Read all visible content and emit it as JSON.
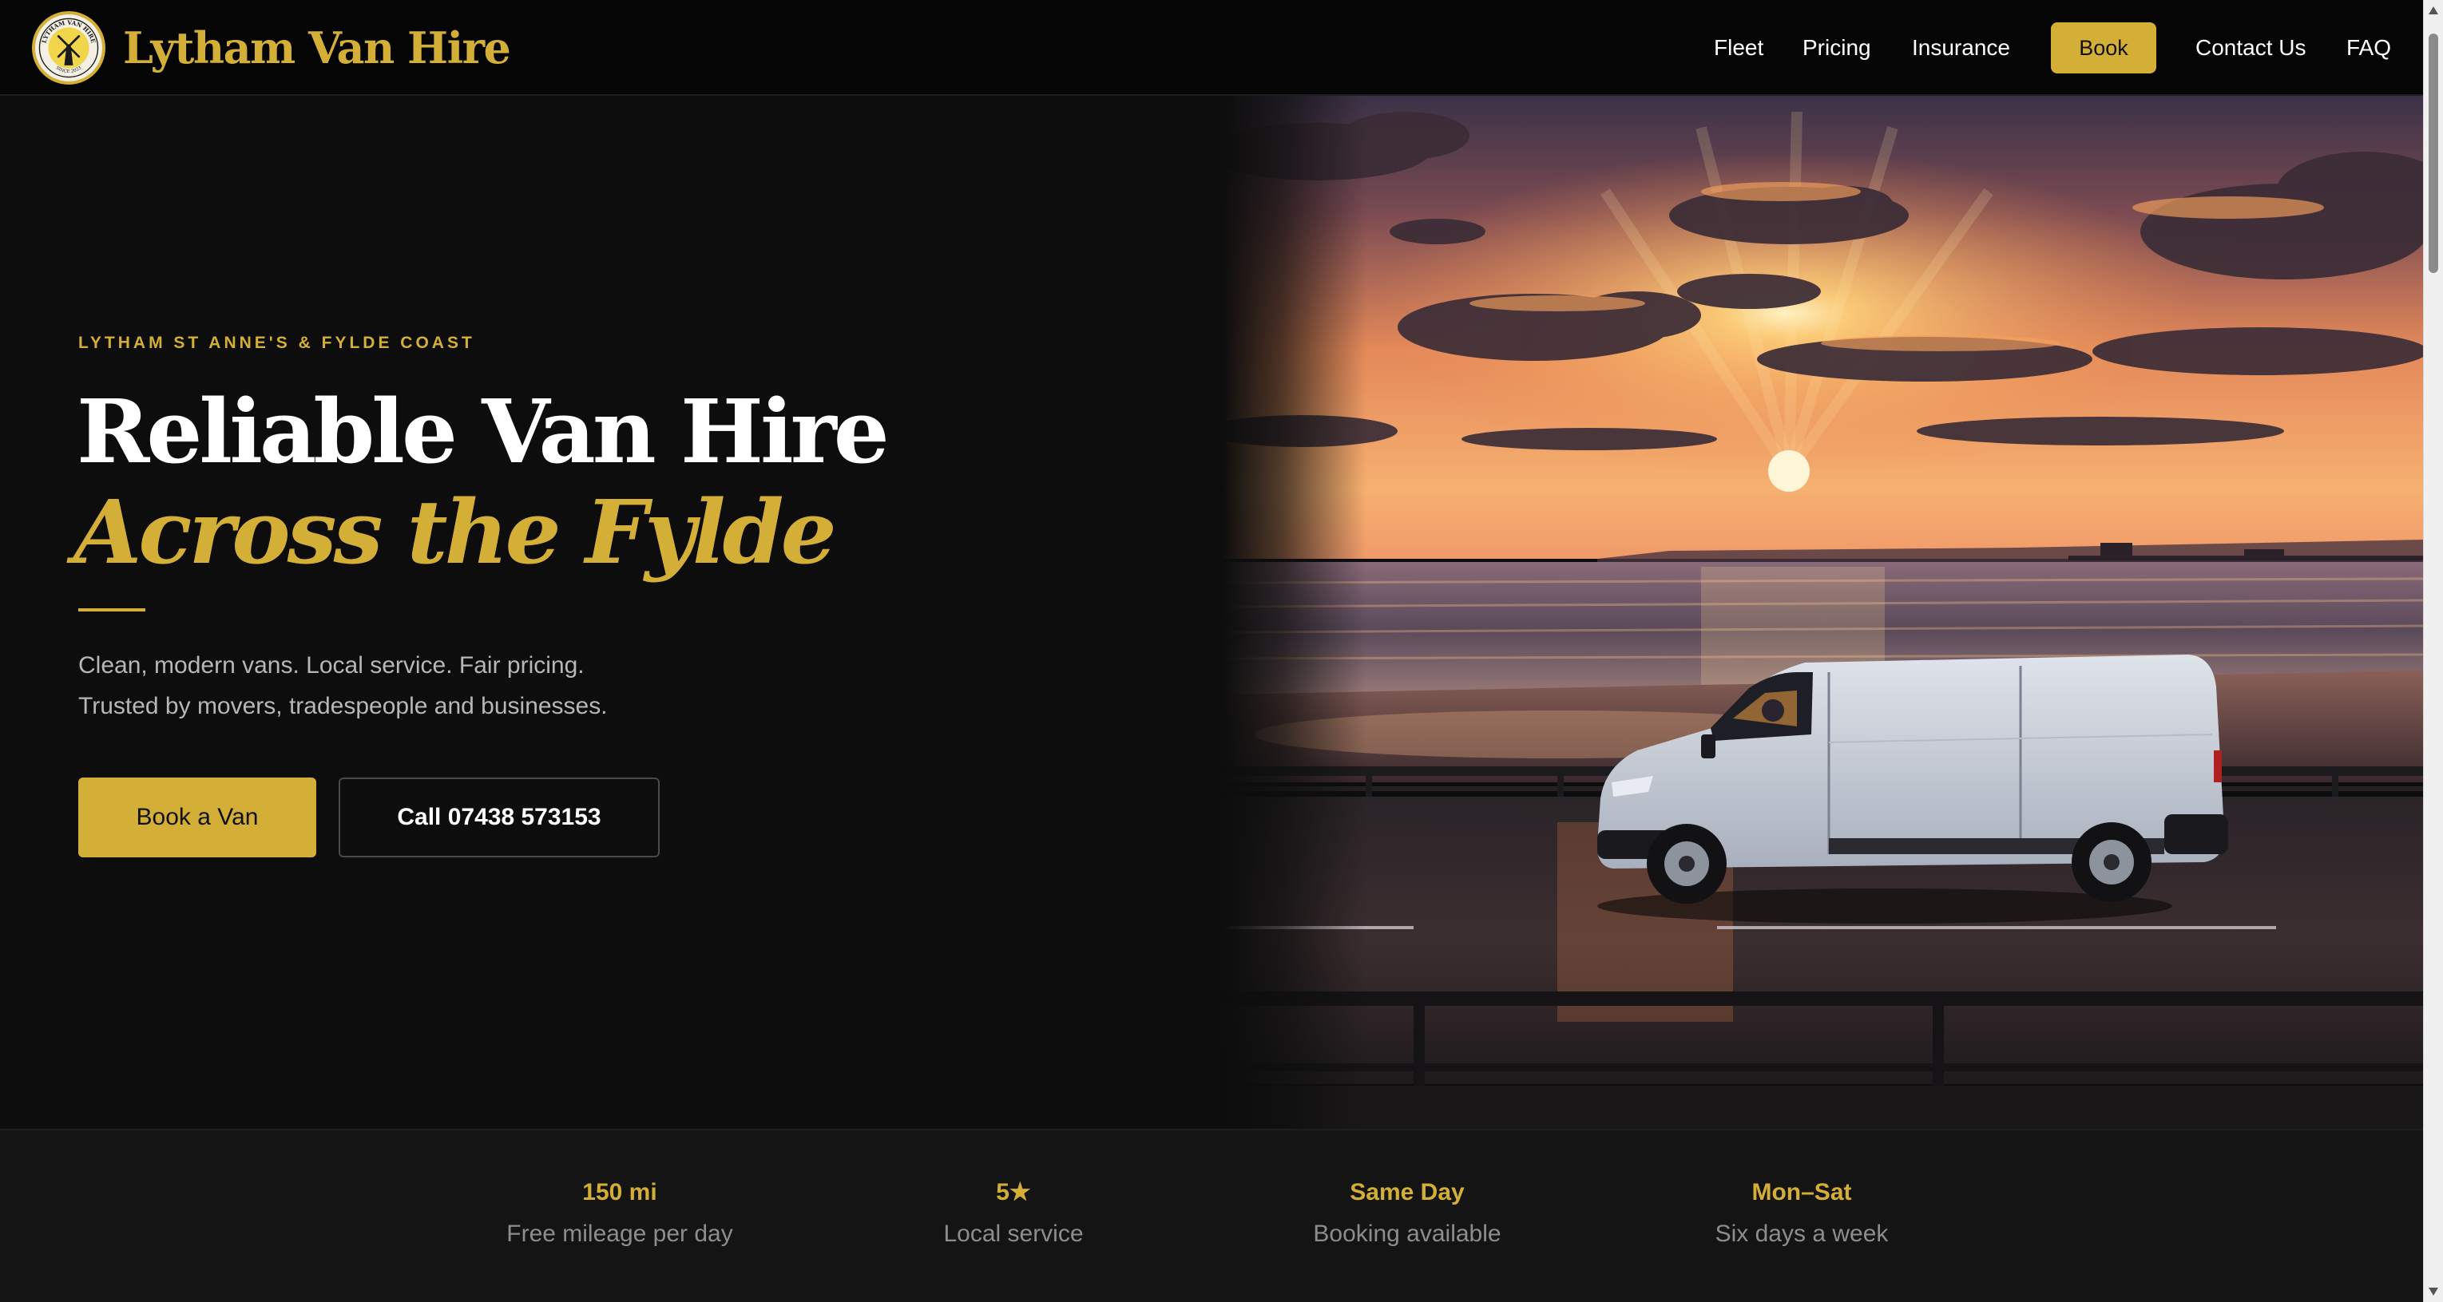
{
  "header": {
    "brand": "Lytham Van Hire",
    "logo": {
      "ring_top": "LYTHAM VAN HIRE",
      "ring_bottom": "SINCE 2023",
      "icon": "windmill-icon"
    },
    "nav": {
      "fleet": "Fleet",
      "pricing": "Pricing",
      "insurance": "Insurance",
      "book": "Book",
      "contact": "Contact Us",
      "faq": "FAQ"
    }
  },
  "hero": {
    "eyebrow": "LYTHAM ST ANNE'S & FYLDE COAST",
    "headline": "Reliable Van Hire",
    "headline_accent": "Across the Fylde",
    "subline_1": "Clean, modern vans. Local service. Fair pricing.",
    "subline_2": "Trusted by movers, tradespeople and businesses.",
    "primary_button": "Book a Van",
    "secondary_button": "Call 07438 573153",
    "image_subject": "white van on coastal road at sunset"
  },
  "stats": [
    {
      "value": "150 mi",
      "label": "Free mileage per day"
    },
    {
      "value": "5★",
      "label": "Local service"
    },
    {
      "value": "Same Day",
      "label": "Booking available"
    },
    {
      "value": "Mon–Sat",
      "label": "Six days a week"
    }
  ],
  "colors": {
    "accent": "#d4af37",
    "background": "#0d0d0d",
    "header": "#050505",
    "muted_text": "#b7b7b7"
  }
}
